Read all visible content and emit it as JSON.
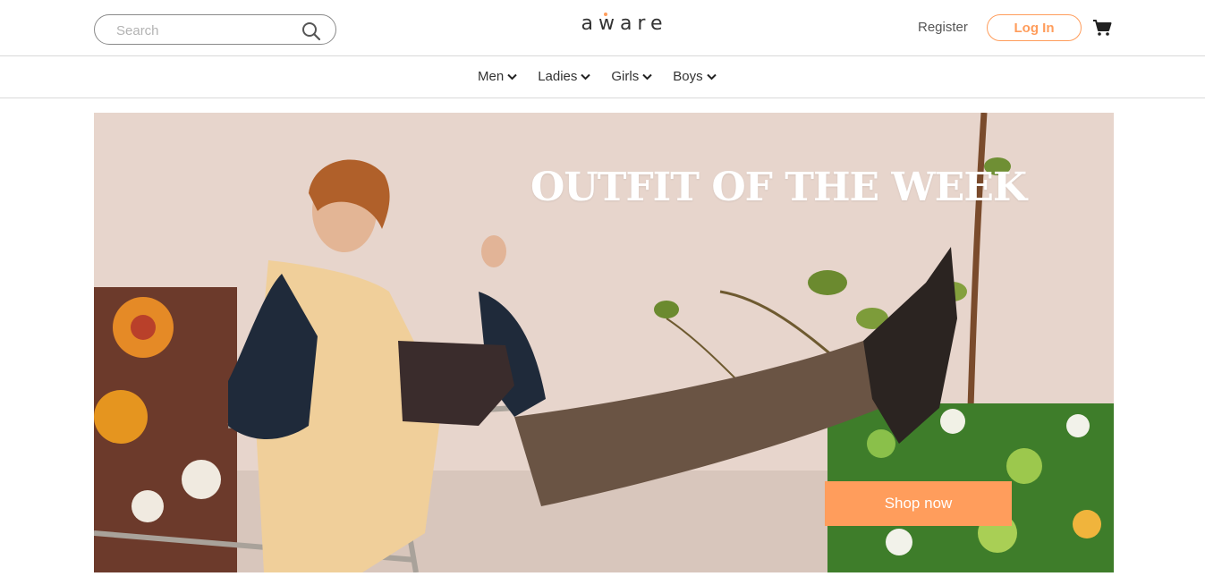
{
  "header": {
    "search": {
      "placeholder": "Search",
      "value": ""
    },
    "logo": "aware",
    "register_label": "Register",
    "login_label": "Log In"
  },
  "nav": {
    "items": [
      {
        "label": "Men"
      },
      {
        "label": "Ladies"
      },
      {
        "label": "Girls"
      },
      {
        "label": "Boys"
      }
    ]
  },
  "hero": {
    "title": "OUTFIT OF THE WEEK",
    "cta_label": "Shop now"
  },
  "colors": {
    "accent": "#ff9d5c",
    "text": "#333333",
    "border": "#d9d9d9"
  },
  "icons": [
    "search-icon",
    "cart-icon",
    "chevron-down-icon"
  ]
}
